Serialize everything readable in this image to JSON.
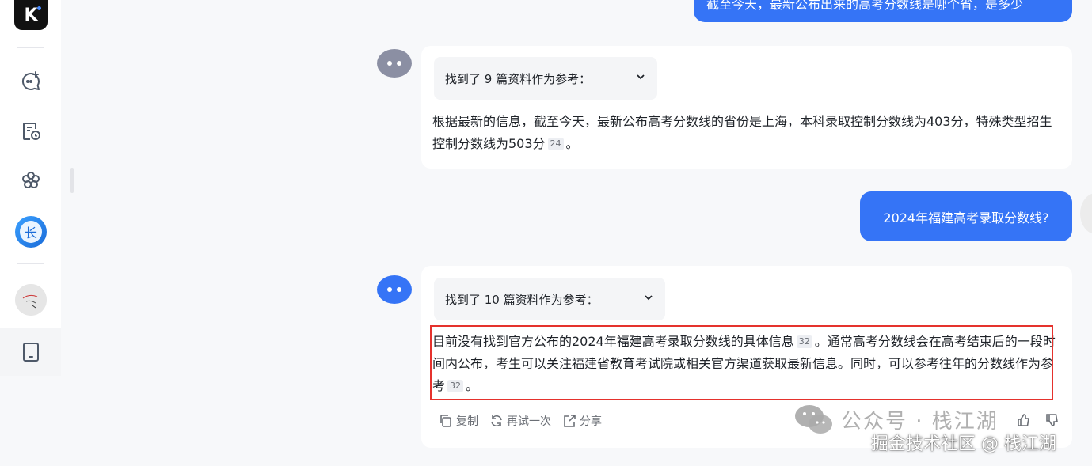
{
  "sidebar": {
    "logo_letter": "K",
    "items": [
      {
        "icon": "new-chat-icon"
      },
      {
        "icon": "history-icon"
      },
      {
        "icon": "explore-icon"
      },
      {
        "icon": "long-text-assistant-icon",
        "glyph": "长"
      },
      {
        "icon": "user-avatar-icon"
      },
      {
        "icon": "device-icon"
      }
    ]
  },
  "conversation": {
    "user_top_message": "截至今天，最新公布出来的高考分数线是哪个省，是多少",
    "bot_1": {
      "refs_label": "找到了 9 篇资料作为参考：",
      "answer_text": "根据最新的信息，截至今天，最新公布高考分数线的省份是上海，本科录取控制分数线为403分，特殊类型招生控制分数线为503分",
      "citation": "24",
      "answer_end": "。"
    },
    "user_message_2": "2024年福建高考录取分数线?",
    "bot_2": {
      "refs_label": "找到了 10 篇资料作为参考：",
      "answer_part1": "目前没有找到官方公布的2024年福建高考录取分数线的具体信息",
      "citation_1": "32",
      "answer_part2": "。通常高考分数线会在高考结束后的一段时间内公布，考生可以关注福建省教育考试院或相关官方渠道获取最新信息。同时，可以参考往年的分数线作为参考",
      "citation_2": "32",
      "answer_end": "。",
      "actions": {
        "copy": "复制",
        "retry": "再试一次",
        "share": "分享"
      }
    }
  },
  "watermark": {
    "line1": "公众号 · 栈江湖",
    "line2": "掘金技术社区 @ 栈江湖"
  },
  "colors": {
    "accent": "#3574f6",
    "highlight": "#e5322d",
    "bot_avatar_old": "#8b8fa3",
    "bot_avatar_new": "#3574f6"
  }
}
